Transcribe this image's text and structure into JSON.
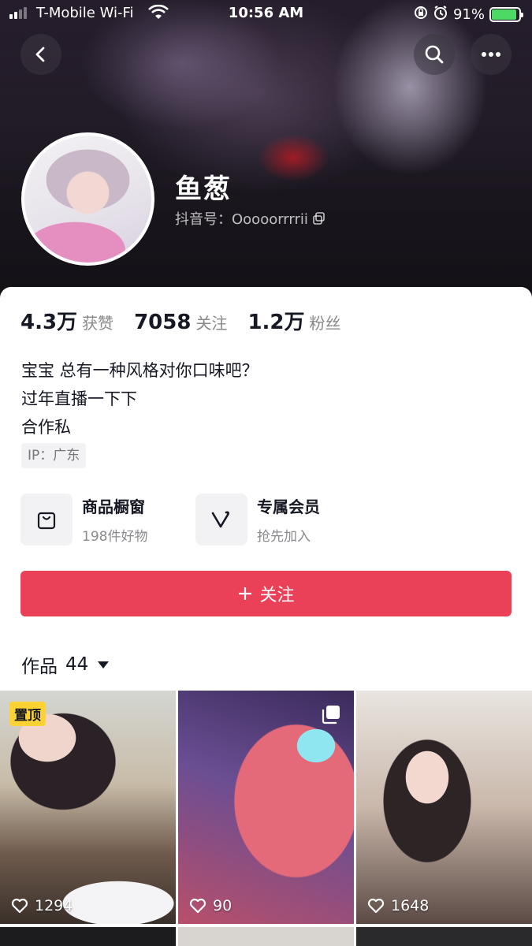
{
  "status_bar": {
    "carrier": "T-Mobile Wi-Fi",
    "time": "10:56 AM",
    "battery_percent": "91%",
    "battery_level": 0.91
  },
  "profile": {
    "name": "鱼葱",
    "account_id": "抖音号：Ooooorrrrii"
  },
  "stats": [
    {
      "value": "4.3万",
      "label": "获赞"
    },
    {
      "value": "7058",
      "label": "关注"
    },
    {
      "value": "1.2万",
      "label": "粉丝"
    }
  ],
  "bio": {
    "lines": [
      "宝宝 总有一种风格对你口味吧？",
      "过年直播一下下",
      "合作私"
    ],
    "ip": "IP：广东"
  },
  "features": [
    {
      "title": "商品橱窗",
      "subtitle": "198件好物",
      "icon": "shopping-bag-icon"
    },
    {
      "title": "专属会员",
      "subtitle": "抢先加入",
      "icon": "member-v-icon"
    }
  ],
  "follow_button": {
    "label": "关注"
  },
  "works_tab": {
    "label": "作品",
    "count": "44"
  },
  "grid": [
    {
      "badge": "置顶",
      "likes": "1294"
    },
    {
      "likes": "90",
      "icon": "multi-image-icon"
    },
    {
      "likes": "1648"
    }
  ],
  "colors": {
    "accent": "#ea4158",
    "pin_badge": "#fdd235",
    "battery": "#4cd964"
  }
}
